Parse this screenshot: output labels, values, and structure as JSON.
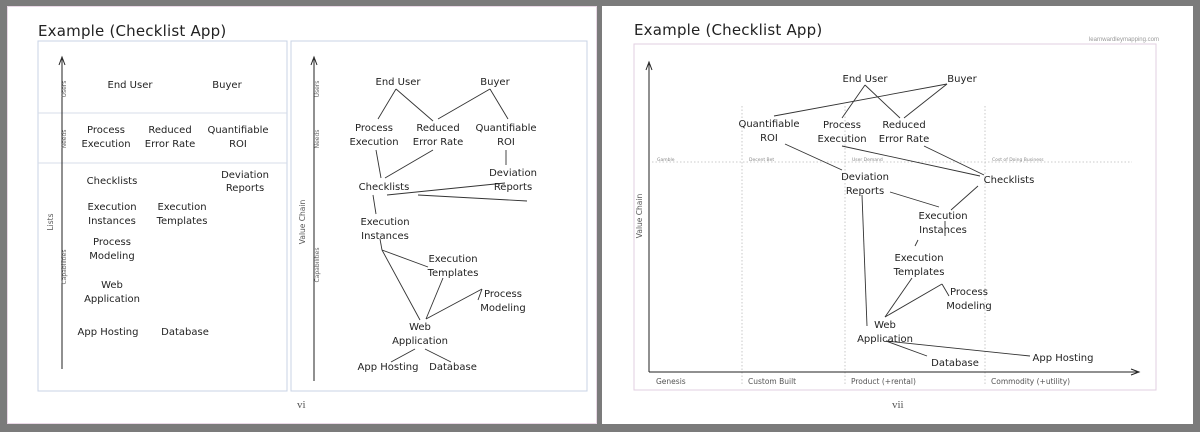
{
  "left_page": {
    "title": "Example (Checklist App)",
    "page_number": "vi",
    "list_panel": {
      "axis_label": "Lists",
      "bands": [
        "Users",
        "Needs",
        "Capabilities"
      ],
      "users": [
        "End User",
        "Buyer"
      ],
      "needs": [
        [
          "Process",
          "Execution"
        ],
        [
          "Reduced",
          "Error Rate"
        ],
        [
          "Quantifiable",
          "ROI"
        ]
      ],
      "capabilities": [
        [
          "Checklists"
        ],
        [
          "Deviation",
          "Reports"
        ],
        [
          "Execution",
          "Instances"
        ],
        [
          "Execution",
          "Templates"
        ],
        [
          "Process",
          "Modeling"
        ],
        [
          "Web",
          "Application"
        ],
        [
          "App Hosting"
        ],
        [
          "Database"
        ]
      ]
    },
    "chain_panel": {
      "axis_label": "Value Chain",
      "bands": [
        "Users",
        "Needs",
        "Capabilities"
      ],
      "nodes": [
        [
          "End User"
        ],
        [
          "Buyer"
        ],
        [
          "Process",
          "Execution"
        ],
        [
          "Reduced",
          "Error Rate"
        ],
        [
          "Quantifiable",
          "ROI"
        ],
        [
          "Checklists"
        ],
        [
          "Deviation",
          "Reports"
        ],
        [
          "Execution",
          "Instances"
        ],
        [
          "Execution",
          "Templates"
        ],
        [
          "Process",
          "Modeling"
        ],
        [
          "Web",
          "Application"
        ],
        [
          "App Hosting"
        ],
        [
          "Database"
        ]
      ]
    }
  },
  "right_page": {
    "title": "Example (Checklist App)",
    "credit": "learnwardleymapping.com",
    "page_number": "vii",
    "y_axis_label": "Value Chain",
    "stages": [
      "Genesis",
      "Custom Built",
      "Product (+rental)",
      "Commodity (+utility)"
    ],
    "stage_notes": [
      "Gamble",
      "Decent Bet",
      "User Demand",
      "Cost of Doing Business"
    ],
    "components": [
      [
        "End User"
      ],
      [
        "Buyer"
      ],
      [
        "Quantifiable",
        "ROI"
      ],
      [
        "Process",
        "Execution"
      ],
      [
        "Reduced",
        "Error Rate"
      ],
      [
        "Deviation",
        "Reports"
      ],
      [
        "Checklists"
      ],
      [
        "Execution",
        "Instances"
      ],
      [
        "Execution",
        "Templates"
      ],
      [
        "Process",
        "Modeling"
      ],
      [
        "Web",
        "Application"
      ],
      [
        "Database"
      ],
      [
        "App Hosting"
      ]
    ]
  }
}
